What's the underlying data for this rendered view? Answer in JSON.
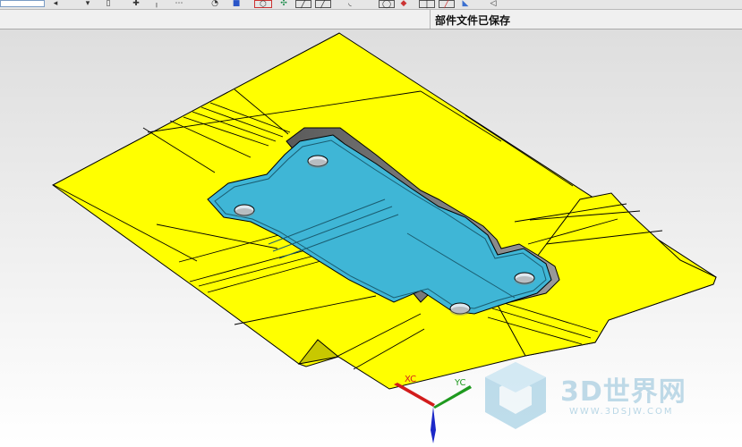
{
  "status_bar": {
    "message": "部件文件已保存"
  },
  "toolbar": {
    "icons": [
      "dropdown-icon",
      "arrow-icon",
      "filter-icon",
      "select-icon",
      "snap-icon",
      "point-icon",
      "grid-icon",
      "rotate-view-icon",
      "shaded-cube-icon",
      "wireframe-icon",
      "move-icon",
      "line-icon",
      "arc-icon",
      "circle-icon",
      "sketch-icon",
      "pencil-icon",
      "render-icon"
    ]
  },
  "viewport": {
    "axes": {
      "x_label": "XC",
      "y_label": "YC",
      "x_color": "#d21c1c",
      "y_color": "#1f9a1f",
      "z_color": "#1c28c8"
    },
    "colors": {
      "background_top": "#ececec",
      "background_bottom": "#ffffff",
      "surface": "#ffff00",
      "pocket": "#3fb6d6"
    }
  },
  "watermark": {
    "brand": "3D世界网",
    "url": "WWW.3DSJW.COM"
  }
}
